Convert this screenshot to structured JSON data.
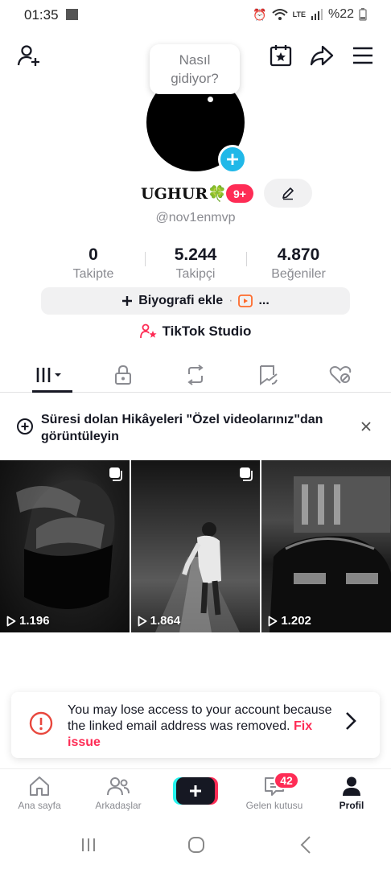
{
  "status_bar": {
    "time": "01:35",
    "battery": "%22",
    "network": "LTE"
  },
  "tooltip": {
    "line1": "Nasıl",
    "line2": "gidiyor?"
  },
  "profile": {
    "username": "UGHUR",
    "username_emoji": "🍀",
    "notification_count": "9+",
    "handle": "@nov1enmvp"
  },
  "stats": [
    {
      "value": "0",
      "label": "Takipte"
    },
    {
      "value": "5.244",
      "label": "Takipçi"
    },
    {
      "value": "4.870",
      "label": "Beğeniler"
    }
  ],
  "bio_button": {
    "label": "Biyografi ekle",
    "suffix": "..."
  },
  "studio_button": {
    "label": "TikTok Studio"
  },
  "tabs": [
    "videos-grid-icon",
    "lock-icon",
    "repost-icon",
    "favorites-icon",
    "liked-icon"
  ],
  "story_banner": {
    "text": "Süresi dolan Hikâyeleri \"Özel videolarınız\"dan görüntüleyin"
  },
  "videos": [
    {
      "views": "1.196"
    },
    {
      "views": "1.864"
    },
    {
      "views": "1.202"
    }
  ],
  "alert": {
    "message": "You may lose access to your account because the linked email address was removed. ",
    "action": "Fix issue"
  },
  "bottom_nav": {
    "home": "Ana sayfa",
    "friends": "Arkadaşlar",
    "inbox": "Gelen kutusu",
    "inbox_count": "42",
    "profile": "Profil"
  },
  "colors": {
    "accent": "#fe2c55",
    "cyan": "#20b8e8",
    "text": "#161823",
    "muted": "#8a8b91"
  }
}
